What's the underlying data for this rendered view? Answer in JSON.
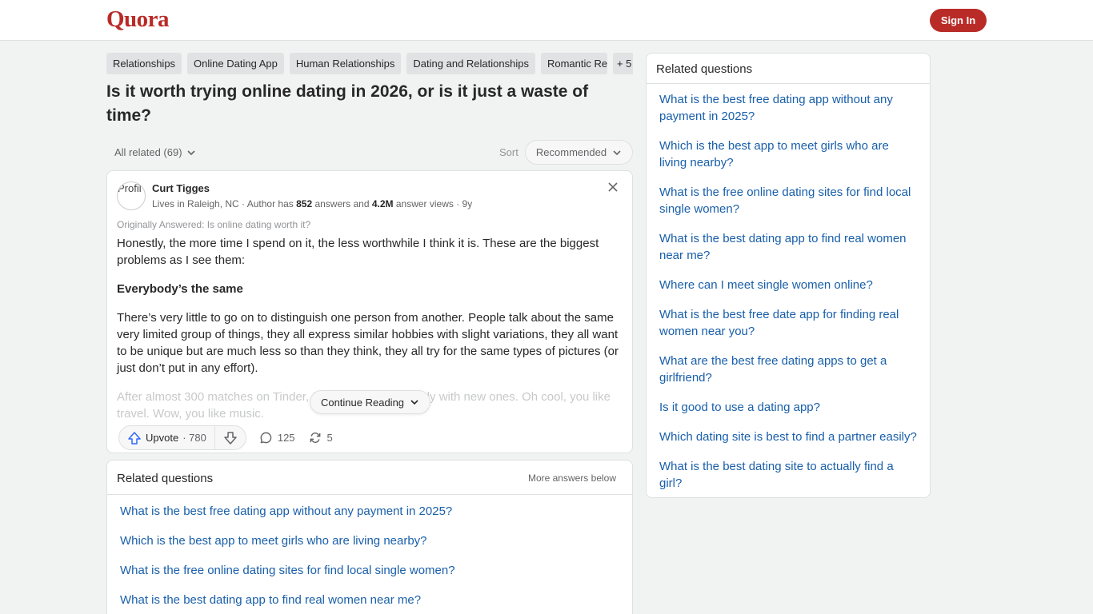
{
  "header": {
    "logo": "Quora",
    "sign_in": "Sign In"
  },
  "topics": [
    "Relationships",
    "Online Dating App",
    "Human Relationships",
    "Dating and Relationships",
    "Romantic Re",
    "+ 5"
  ],
  "question": {
    "title": "Is it worth trying online dating in 2026, or is it just a waste of time?"
  },
  "filter": {
    "all_related": "All related (69)",
    "sort_label": "Sort",
    "sort_value": "Recommended"
  },
  "answer": {
    "avatar_alt": "Profil",
    "author": "Curt Tigges",
    "cred_prefix": "Lives in Raleigh, NC · Author has ",
    "answers_count": "852",
    "cred_mid": " answers and ",
    "views_count": "4.2M",
    "cred_suffix": " answer views · 9y",
    "originally_answered": "Originally Answered: Is online dating worth it?",
    "para1": "Honestly, the more time I spend on it, the less worthwhile I think it is. These are the biggest problems as I see them:",
    "heading1": "Everybody’s the same",
    "para2": "There’s very little to go on to distinguish one person from another. People talk about the same very limited group of things, they all express similar hobbies with slight variations, they all want to be unique but are much less so than they think, they all try for the same types of pictures (or just don’t put in any effort).",
    "para3_faded": "After almost 300 matches on Tinder, I get bored very quickly with new ones. Oh cool, you like travel. Wow, you like music.",
    "continue_reading": "Continue Reading",
    "upvote_label": "Upvote",
    "upvote_count": "· 780",
    "comments": "125",
    "shares": "5"
  },
  "related_feed": {
    "title": "Related questions",
    "more": "More answers below",
    "items": [
      "What is the best free dating app without any payment in 2025?",
      "Which is the best app to meet girls who are living nearby?",
      "What is the free online dating sites for find local single women?",
      "What is the best dating app to find real women near me?"
    ]
  },
  "sidebar": {
    "title": "Related questions",
    "items": [
      "What is the best free dating app without any payment in 2025?",
      "Which is the best app to meet girls who are living nearby?",
      "What is the free online dating sites for find local single women?",
      "What is the best dating app to find real women near me?",
      "Where can I meet single women online?",
      "What is the best free date app for finding real women near you?",
      "What are the best free dating apps to get a girlfriend?",
      "Is it good to use a dating app?",
      "Which dating site is best to find a partner easily?",
      "What is the best dating site to actually find a girl?"
    ]
  },
  "colors": {
    "brand": "#b92b27",
    "link": "#195faa",
    "background": "#f1f2f2"
  }
}
